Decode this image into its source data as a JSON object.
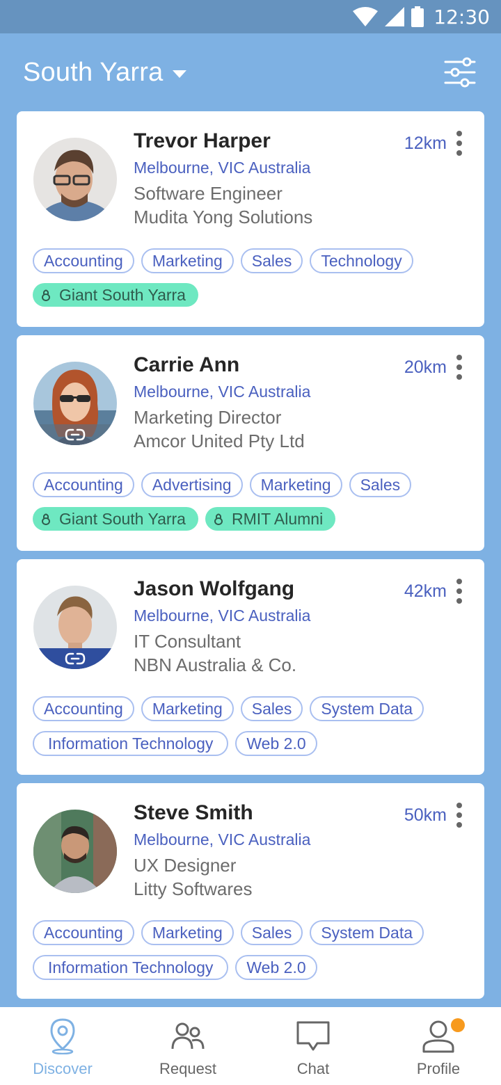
{
  "status_bar": {
    "time": "12:30"
  },
  "header": {
    "location": "South Yarra"
  },
  "people": [
    {
      "name": "Trevor Harper",
      "location": "Melbourne, VIC Australia",
      "role": "Software Engineer",
      "company": "Mudita Yong Solutions",
      "distance": "12km",
      "tags": [
        "Accounting",
        "Marketing",
        "Sales",
        "Technology"
      ],
      "groups": [
        "Giant South Yarra"
      ]
    },
    {
      "name": "Carrie Ann",
      "location": "Melbourne, VIC Australia",
      "role": "Marketing Director",
      "company": "Amcor United Pty Ltd",
      "distance": "20km",
      "tags": [
        "Accounting",
        "Advertising",
        "Marketing",
        "Sales"
      ],
      "groups": [
        "Giant South Yarra",
        "RMIT Alumni"
      ]
    },
    {
      "name": "Jason Wolfgang",
      "location": "Melbourne, VIC Australia",
      "role": "IT Consultant",
      "company": "NBN Australia & Co.",
      "distance": "42km",
      "tags": [
        "Accounting",
        "Marketing",
        "Sales",
        "System Data",
        "Information Technology",
        "Web 2.0"
      ],
      "groups": []
    },
    {
      "name": "Steve Smith",
      "location": "Melbourne, VIC Australia",
      "role": "UX Designer",
      "company": "Litty Softwares",
      "distance": "50km",
      "tags": [
        "Accounting",
        "Marketing",
        "Sales",
        "System Data",
        "Information Technology",
        "Web 2.0"
      ],
      "groups": []
    }
  ],
  "nav": {
    "discover": "Discover",
    "request": "Request",
    "chat": "Chat",
    "profile": "Profile"
  },
  "colors": {
    "background": "#7eb1e3",
    "status_bar": "#6693bf",
    "accent_blue": "#4a60bf",
    "group_green": "#6ee8c1",
    "notification": "#f79a1e"
  }
}
